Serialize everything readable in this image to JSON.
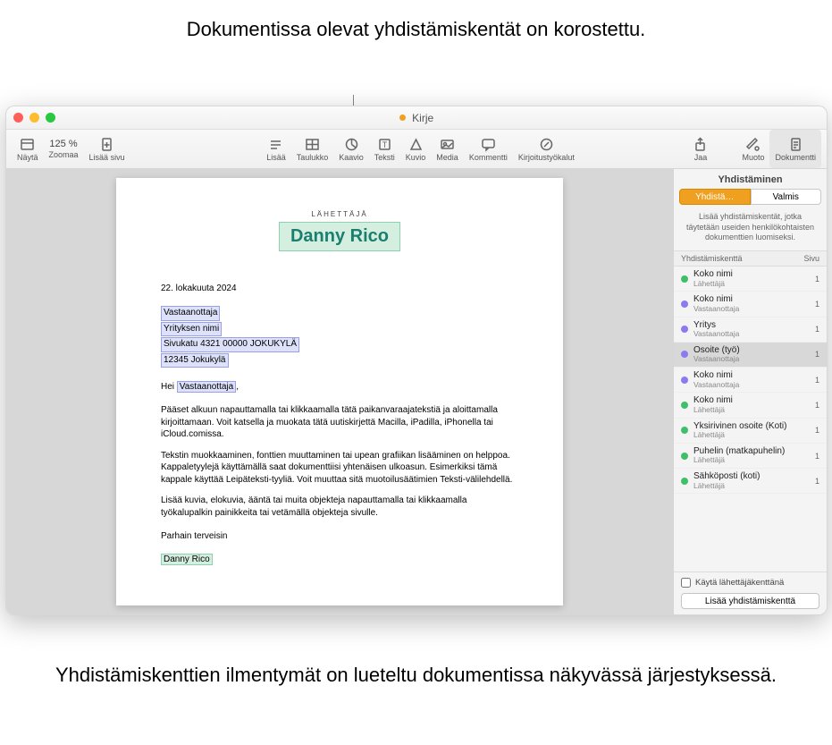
{
  "callouts": {
    "top": "Dokumentissa olevat yhdistämiskentät on korostettu.",
    "bottom": "Yhdistämiskenttien ilmentymät on lueteltu dokumentissa näkyvässä järjestyksessä."
  },
  "window": {
    "title": "Kirje"
  },
  "toolbar": {
    "view": "Näytä",
    "zoom_label": "Zoomaa",
    "zoom_value": "125 %",
    "add_page": "Lisää sivu",
    "insert": "Lisää",
    "table": "Taulukko",
    "chart": "Kaavio",
    "text": "Teksti",
    "shape": "Kuvio",
    "media": "Media",
    "comment": "Kommentti",
    "writing_tools": "Kirjoitustyökalut",
    "share": "Jaa",
    "format": "Muoto",
    "document": "Dokumentti"
  },
  "doc": {
    "sender_label": "LÄHETTÄJÄ",
    "sender_name": "Danny Rico",
    "date": "22. lokakuuta 2024",
    "recipient_name": "Vastaanottaja",
    "company": "Yrityksen nimi",
    "street": "Sivukatu 4321 00000 JOKUKYLÄ",
    "postal": "12345 Jokukylä",
    "greeting_prefix": "Hei ",
    "greeting_field": "Vastaanottaja",
    "greeting_suffix": ",",
    "para1": "Pääset alkuun napauttamalla tai klikkaamalla tätä paikanvaraajatekstiä ja aloittamalla kirjoittamaan. Voit katsella ja muokata tätä uutiskirjettä Macilla, iPadilla, iPhonella tai iCloud.comissa.",
    "para2": "Tekstin muokkaaminen, fonttien muuttaminen tai upean grafiikan lisääminen on helppoa. Kappaletyylejä käyttämällä saat dokumenttiisi yhtenäisen ulkoasun. Esimerkiksi tämä kappale käyttää Leipäteksti-tyyliä. Voit muuttaa sitä muotoilusäätimien Teksti-välilehdellä.",
    "para3": "Lisää kuvia, elokuvia, ääntä tai muita objekteja napauttamalla tai klikkaamalla työkalupalkin painikkeita tai vetämällä objekteja sivulle.",
    "signoff": "Parhain terveisin",
    "signature": "Danny Rico"
  },
  "panel": {
    "title": "Yhdistäminen",
    "btn_merge": "Yhdistä…",
    "btn_done": "Valmis",
    "help": "Lisää yhdistämiskentät, jotka täytetään useiden henkilökohtaisten dokumenttien luomiseksi.",
    "col_field": "Yhdistämiskenttä",
    "col_page": "Sivu",
    "use_as_sender": "Käytä lähettäjäkenttänä",
    "add_field": "Lisää yhdistämiskenttä",
    "fields": [
      {
        "name": "Koko nimi",
        "sub": "Lähettäjä",
        "color": "green",
        "page": "1"
      },
      {
        "name": "Koko nimi",
        "sub": "Vastaanottaja",
        "color": "purple",
        "page": "1"
      },
      {
        "name": "Yritys",
        "sub": "Vastaanottaja",
        "color": "purple",
        "page": "1"
      },
      {
        "name": "Osoite (työ)",
        "sub": "Vastaanottaja",
        "color": "purple",
        "page": "1",
        "selected": true
      },
      {
        "name": "Koko nimi",
        "sub": "Vastaanottaja",
        "color": "purple",
        "page": "1"
      },
      {
        "name": "Koko nimi",
        "sub": "Lähettäjä",
        "color": "green",
        "page": "1"
      },
      {
        "name": "Yksirivinen osoite (Koti)",
        "sub": "Lähettäjä",
        "color": "green",
        "page": "1"
      },
      {
        "name": "Puhelin (matkapuhelin)",
        "sub": "Lähettäjä",
        "color": "green",
        "page": "1"
      },
      {
        "name": "Sähköposti (koti)",
        "sub": "Lähettäjä",
        "color": "green",
        "page": "1"
      }
    ]
  }
}
